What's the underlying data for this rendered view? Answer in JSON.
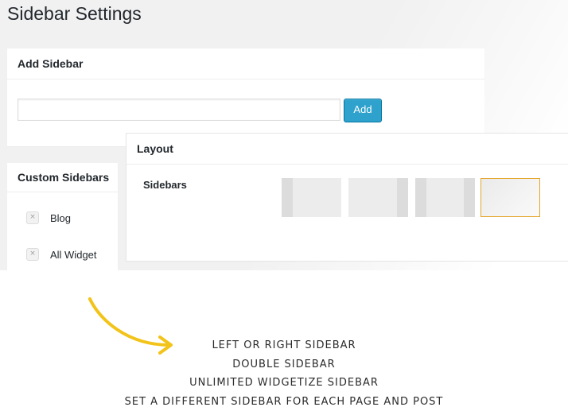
{
  "page": {
    "title": "Sidebar Settings"
  },
  "add_sidebar": {
    "heading": "Add Sidebar",
    "input_value": "",
    "button_label": "Add"
  },
  "custom_sidebars": {
    "heading": "Custom Sidebars",
    "items": [
      {
        "delete_icon": "×",
        "label": "Blog"
      },
      {
        "delete_icon": "×",
        "label": "All Widget"
      }
    ]
  },
  "layout": {
    "heading": "Layout",
    "sidebars_label": "Sidebars",
    "options": [
      "left-sidebar",
      "right-sidebar",
      "double-sidebar",
      "no-sidebar"
    ],
    "selected": "no-sidebar"
  },
  "features": [
    "Left or right sidebar",
    "Double sidebar",
    "Unlimited widgetize sidebar",
    "Set a different sidebar for each page and post"
  ],
  "colors": {
    "button": "#2ea2cc",
    "selected_outline": "#e4a62b",
    "arrow": "#f2c318"
  },
  "icons": {
    "delete": "close-icon",
    "arrow": "curved-arrow-icon"
  }
}
